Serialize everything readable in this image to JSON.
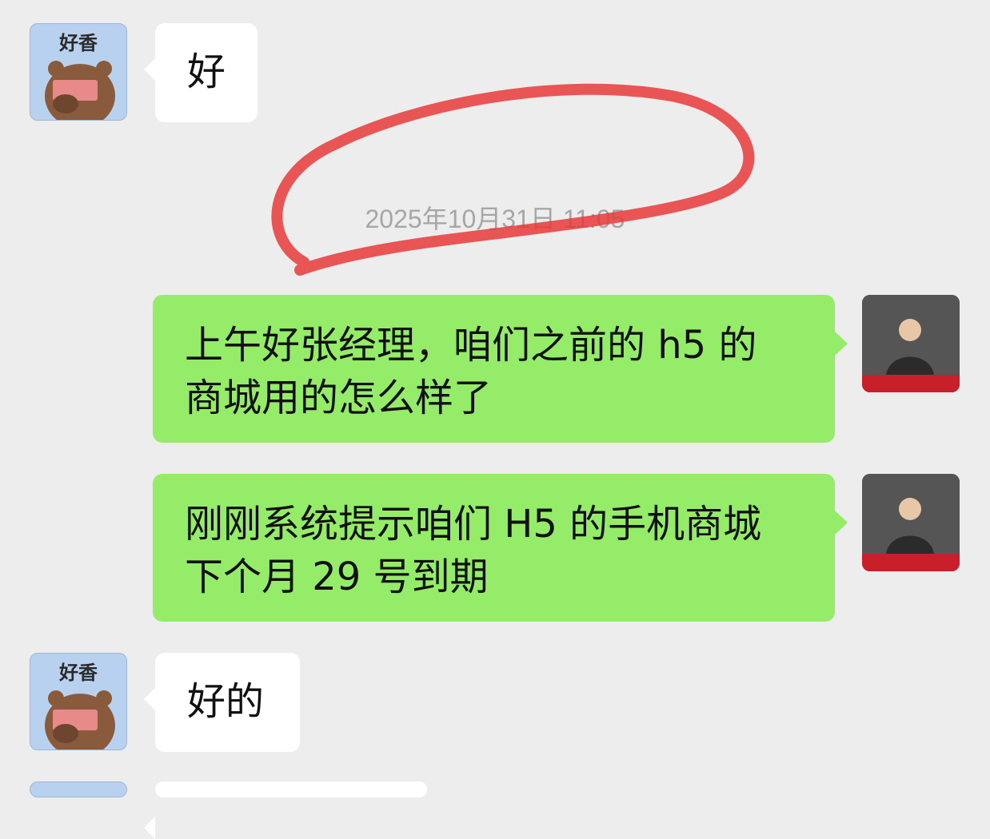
{
  "timestamp": "2025年10月31日 11:05",
  "avatars": {
    "contact_text": "好香"
  },
  "messages": [
    {
      "side": "left",
      "text": "好"
    },
    {
      "side": "right",
      "text_line1": "上午好张经理，咱们之前的 h5 的",
      "text_line2": "商城用的怎么样了"
    },
    {
      "side": "right",
      "text_line1": "刚刚系统提示咱们 H5 的手机商城",
      "text_line2": "下个月 29 号到期"
    },
    {
      "side": "left",
      "text": "好的"
    }
  ],
  "colors": {
    "background": "#ededed",
    "bubble_self": "#95ec69",
    "bubble_other": "#ffffff",
    "annotation": "#e83a3a"
  }
}
